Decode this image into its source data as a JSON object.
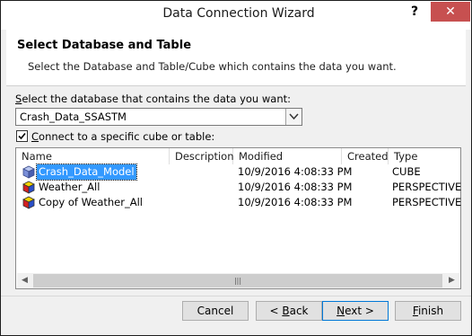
{
  "window": {
    "title": "Data Connection Wizard",
    "help_label": "?",
    "close_label": "✕"
  },
  "header": {
    "title": "Select Database and Table",
    "subtitle": "Select the Database and Table/Cube which contains the data you want."
  },
  "database": {
    "label": "Select the database that contains the data you want:",
    "selected": "Crash_Data_SSASTM"
  },
  "connect_checkbox": {
    "label": "Connect to a specific cube or table:",
    "checked": true
  },
  "table": {
    "columns": [
      "Name",
      "Description",
      "Modified",
      "Created",
      "Type"
    ],
    "rows": [
      {
        "name": "Crash_Data_Model",
        "description": "",
        "modified": "10/9/2016 4:08:33 PM",
        "created": "",
        "type": "CUBE",
        "icon": "cube-icon",
        "selected": true
      },
      {
        "name": "Weather_All",
        "description": "",
        "modified": "10/9/2016 4:08:33 PM",
        "created": "",
        "type": "PERSPECTIVE",
        "icon": "perspective-icon",
        "selected": false
      },
      {
        "name": "Copy of Weather_All",
        "description": "",
        "modified": "10/9/2016 4:08:33 PM",
        "created": "",
        "type": "PERSPECTIVE",
        "icon": "perspective-icon",
        "selected": false
      }
    ]
  },
  "buttons": {
    "cancel": "Cancel",
    "back": {
      "prefix": "< ",
      "accel": "B",
      "rest": "ack"
    },
    "next": {
      "accel": "N",
      "rest": "ext >"
    },
    "finish": {
      "accel": "F",
      "rest": "inish"
    }
  }
}
